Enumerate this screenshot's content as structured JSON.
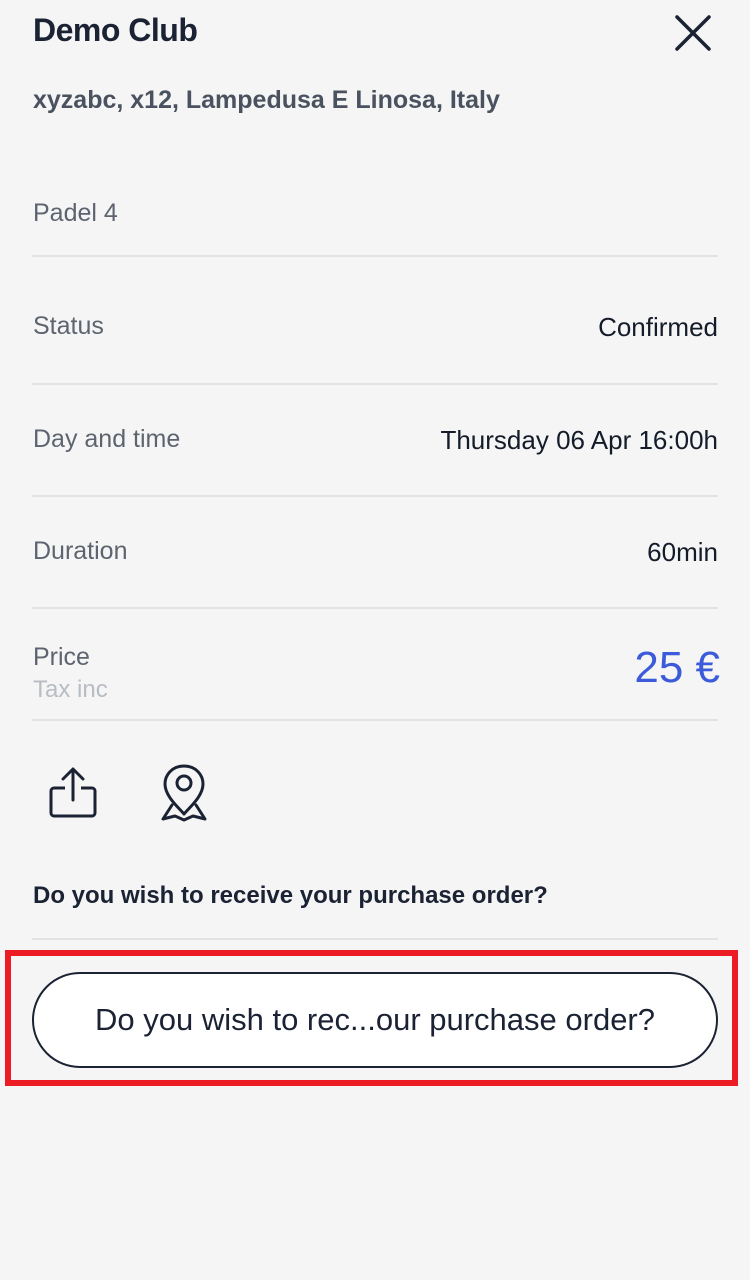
{
  "header": {
    "club_name": "Demo Club",
    "close_icon": "close-icon",
    "address": "xyzabc, x12, Lampedusa E Linosa, Italy"
  },
  "details": {
    "court": "Padel 4",
    "status_label": "Status",
    "status_value": "Confirmed",
    "day_label": "Day and time",
    "day_value": "Thursday 06 Apr 16:00h",
    "duration_label": "Duration",
    "duration_value": "60min",
    "price_label": "Price",
    "price_sublabel": "Tax inc",
    "price_value": "25 €"
  },
  "actions": {
    "share_icon": "share-icon",
    "map_icon": "map-pin-icon"
  },
  "purchase_order": {
    "question": "Do you wish to receive your purchase order?",
    "button_label": "Do you wish to rec...our purchase order?"
  },
  "colors": {
    "accent": "#3b5bdb",
    "highlight": "#ec1c24",
    "text": "#1b2233",
    "background": "#f5f5f5"
  }
}
